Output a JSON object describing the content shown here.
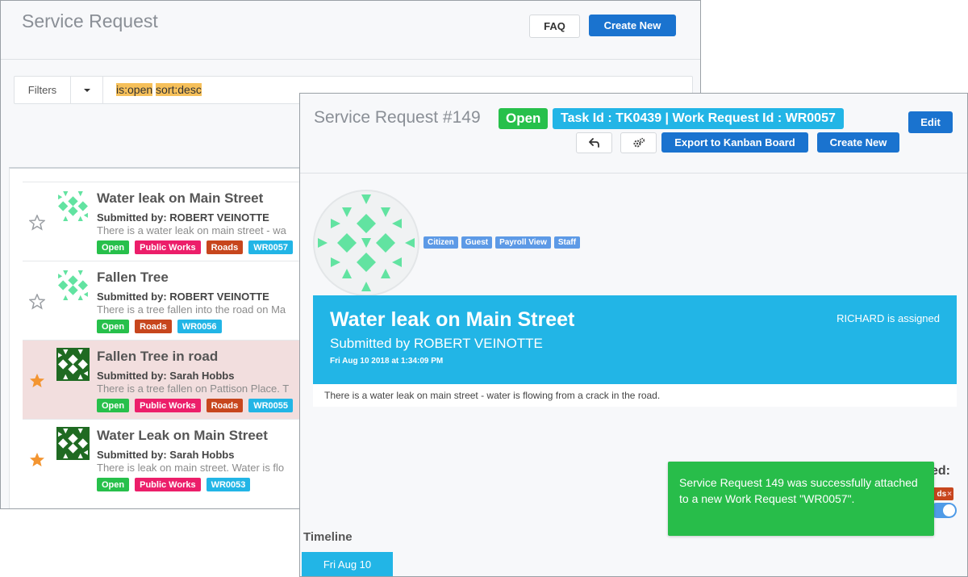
{
  "colors": {
    "primary": "#1a73cf",
    "open": "#27c04b",
    "public_works": "#ec1e6a",
    "roads": "#c7461d",
    "work_request": "#22b5e6",
    "star_active": "#f39531",
    "star_inactive": "#9a9ea3",
    "toast": "#28bd4a"
  },
  "list_window": {
    "title": "Service Request",
    "faq_label": "FAQ",
    "create_label": "Create New",
    "filter": {
      "label": "Filters",
      "query_tokens": [
        "is:open",
        "sort:desc"
      ]
    },
    "requests": [
      {
        "title": "Water leak on Main Street",
        "submitted_by": "Submitted by: ROBERT VEINOTTE",
        "description": "There is a water leak on main street - wa",
        "starred": false,
        "avatar": "light-green-pattern-avatar",
        "tags": [
          {
            "label": "Open",
            "color": "#27c04b"
          },
          {
            "label": "Public Works",
            "color": "#ec1e6a"
          },
          {
            "label": "Roads",
            "color": "#c7461d"
          },
          {
            "label": "WR0057",
            "color": "#22b5e6"
          }
        ]
      },
      {
        "title": "Fallen Tree",
        "submitted_by": "Submitted by: ROBERT VEINOTTE",
        "description": "There is a tree fallen into the road on Ma",
        "starred": false,
        "avatar": "light-green-pattern-avatar",
        "tags": [
          {
            "label": "Open",
            "color": "#27c04b"
          },
          {
            "label": "Roads",
            "color": "#c7461d"
          },
          {
            "label": "WR0056",
            "color": "#22b5e6"
          }
        ]
      },
      {
        "title": "Fallen Tree in road",
        "submitted_by": "Submitted by: Sarah Hobbs",
        "description": "There is a tree fallen on Pattison Place. T",
        "starred": true,
        "selected": true,
        "avatar": "dark-green-pattern-avatar",
        "tags": [
          {
            "label": "Open",
            "color": "#27c04b"
          },
          {
            "label": "Public Works",
            "color": "#ec1e6a"
          },
          {
            "label": "Roads",
            "color": "#c7461d"
          },
          {
            "label": "WR0055",
            "color": "#22b5e6"
          }
        ]
      },
      {
        "title": "Water Leak on Main Street",
        "submitted_by": "Submitted by: Sarah Hobbs",
        "description": "There is leak on main street.  Water is flo",
        "starred": true,
        "avatar": "dark-green-pattern-avatar",
        "tags": [
          {
            "label": "Open",
            "color": "#27c04b"
          },
          {
            "label": "Public Works",
            "color": "#ec1e6a"
          },
          {
            "label": "WR0053",
            "color": "#22b5e6"
          }
        ]
      }
    ]
  },
  "detail_window": {
    "title": "Service Request #149",
    "status_badge": "Open",
    "task_badge": "Task Id : TK0439 | Work Request Id : WR0057",
    "edit_label": "Edit",
    "undo_icon": "reply-icon",
    "settings_icon": "gears-icon",
    "export_label": "Export to Kanban Board",
    "create_label": "Create New",
    "roles": [
      "Citizen",
      "Guest",
      "Payroll View",
      "Staff"
    ],
    "banner": {
      "title": "Water leak on Main Street",
      "submitted": "Submitted by ROBERT VEINOTTE",
      "date": "Fri Aug 10 2018 at 1:34:09 PM",
      "assigned": "RICHARD is assigned"
    },
    "description": "There is a water leak on main street - water is flowing from a crack in the road.",
    "partial_label": "ed:",
    "partial_tag": "ds",
    "toast": "Service Request 149 was successfully attached to a new Work Request \"WR0057\".",
    "timeline_label": "Timeline",
    "timeline_tab": "Fri Aug 10"
  }
}
